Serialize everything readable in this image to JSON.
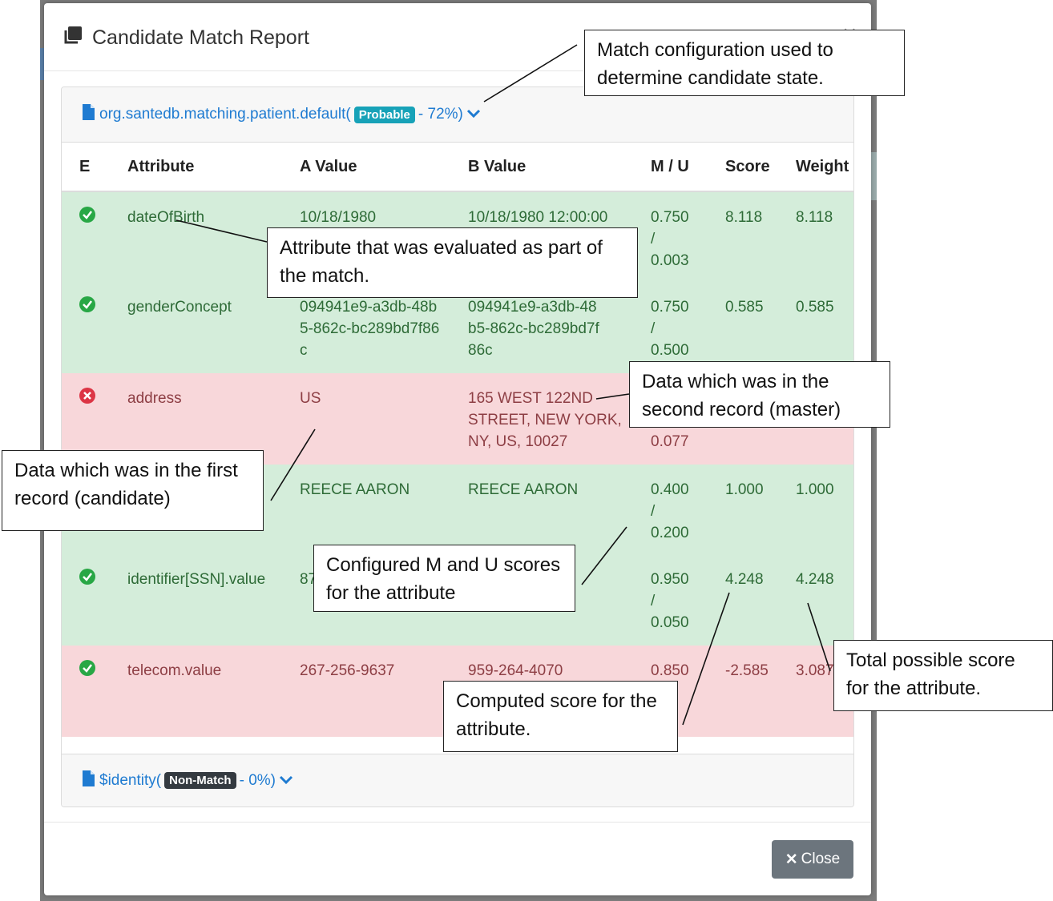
{
  "modal": {
    "title": "Candidate Match Report",
    "close_x": "×",
    "close_button": "Close"
  },
  "config": {
    "name": "org.santedb.matching.patient.default",
    "open_paren": " (",
    "badge": "Probable",
    "suffix": " - 72%)"
  },
  "identity": {
    "name": "$identity",
    "open_paren": " (",
    "badge": "Non-Match",
    "suffix": " - 0%)"
  },
  "table": {
    "headers": [
      "E",
      "Attribute",
      "A Value",
      "B Value",
      "M / U",
      "Score",
      "Weight"
    ],
    "rows": [
      {
        "status": "match",
        "attribute": "dateOfBirth",
        "a": "10/18/1980",
        "b": "10/18/1980 12:00:00",
        "m": "0.750",
        "u": "0.003",
        "score": "8.118",
        "weight": "8.118"
      },
      {
        "status": "match",
        "attribute": "genderConcept",
        "a": "094941e9-a3db-48b5-862c-bc289bd7f86c",
        "b": "094941e9-a3db-48b5-862c-bc289bd7f86c",
        "m": "0.750",
        "u": "0.500",
        "score": "0.585",
        "weight": "0.585"
      },
      {
        "status": "nonmatch",
        "attribute": "address",
        "a": "US",
        "b": "165 WEST 122ND STREET, NEW YORK, NY, US, 10027",
        "m": "",
        "u": "0.077",
        "score": "",
        "weight": ""
      },
      {
        "status": "match",
        "attribute": "",
        "a": "REECE AARON",
        "b": "REECE AARON",
        "m": "0.400",
        "u": "0.200",
        "score": "1.000",
        "weight": "1.000"
      },
      {
        "status": "match",
        "attribute": "identifier[SSN].value",
        "a": "879",
        "b": "",
        "m": "0.950",
        "u": "0.050",
        "score": "4.248",
        "weight": "4.248"
      },
      {
        "status": "nonmatch-check",
        "attribute": "telecom.value",
        "a": "267-256-9637",
        "b": "959-264-4070",
        "m": "0.850",
        "u": "",
        "score": "-2.585",
        "weight": "3.087"
      }
    ]
  },
  "callouts": {
    "config": "Match configuration used to determine candidate state.",
    "attribute": "Attribute that was evaluated as part of the match.",
    "second": "Data which was in the second record (master)",
    "first": "Data which was in the first record (candidate)",
    "mu": "Configured M and U scores for the attribute",
    "score": "Computed score for the attribute.",
    "weight": "Total possible score for the attribute."
  },
  "colors": {
    "match_row": "#d4edda",
    "nonmatch_row": "#f8d7da",
    "link": "#1f7bd1",
    "probable_badge": "#17a2b8",
    "nonmatch_badge": "#343a40",
    "close_button": "#6c757d"
  }
}
